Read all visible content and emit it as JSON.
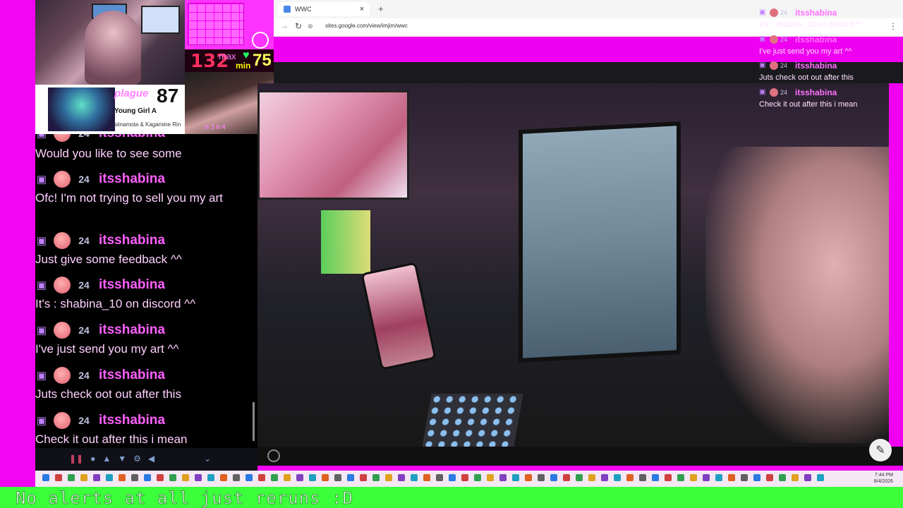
{
  "browser": {
    "tab_title": "WWC",
    "new_tab": "+",
    "tab_close": "×",
    "url": "sites.google.com/view/imjim/wwc"
  },
  "stats": {
    "bpm": "132",
    "max_label": "max",
    "min_label": "min",
    "min_value": "75"
  },
  "handcam_tag": "m3m4",
  "song": {
    "rank_label": "plague",
    "score": "87",
    "title": "Young Girl A",
    "artist": "siinamota & Kagamine Rin"
  },
  "chat": {
    "username": "itsshabina",
    "sub_months": "24",
    "partial_top": "itsshabina",
    "messages": [
      "Would you like to see some",
      "Ofc! I'm not trying to sell you my art",
      "Just give some feedback ^^",
      "It's : shabina_10 on discord ^^",
      "I've just send you my art ^^",
      "Juts check oot out after this",
      "Check it out after this i mean"
    ]
  },
  "overlay": {
    "username": "itsshabina",
    "messages": [
      "It's : shabina_10 on discord ^^",
      "I've just send you my art ^^",
      "Juts check oot out after this",
      "Check it out after this i mean"
    ]
  },
  "taskbar": {
    "time": "7:44 PM",
    "date": "8/4/2026"
  },
  "ticker": {
    "text": "No alerts at all just reruns :D"
  },
  "colors": {
    "magenta": "#f200f2",
    "ticker_green": "#3cff3c",
    "chat_username": "#ff60ff"
  }
}
